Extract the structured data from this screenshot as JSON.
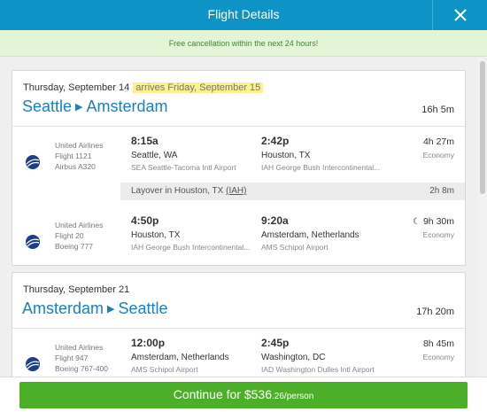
{
  "header": {
    "title": "Flight Details",
    "close_icon": "close-icon"
  },
  "banner": {
    "text": "Free cancellation within the next 24 hours!"
  },
  "trips": [
    {
      "date": "Thursday, September 14",
      "arrives_note": "arrives Friday, September 15",
      "origin": "Seattle",
      "destination": "Amsterdam",
      "duration": "16h 5m",
      "segments": [
        {
          "airline": "United Airlines",
          "flight": "Flight 1121",
          "aircraft": "Airbus A320",
          "dep_time": "8:15a",
          "dep_city": "Seattle, WA",
          "dep_airport": "SEA Seattle-Tacoma Intl Airport",
          "arr_time": "2:42p",
          "arr_city": "Houston, TX",
          "arr_airport": "IAH George Bush Intercontinental...",
          "duration": "4h 27m",
          "cabin": "Economy",
          "overnight": false
        },
        {
          "airline": "United Airlines",
          "flight": "Flight 20",
          "aircraft": "Boeing 777",
          "dep_time": "4:50p",
          "dep_city": "Houston, TX",
          "dep_airport": "IAH George Bush Intercontinental...",
          "arr_time": "9:20a",
          "arr_city": "Amsterdam, Netherlands",
          "arr_airport": "AMS Schipol Airport",
          "duration": "9h 30m",
          "cabin": "Economy",
          "overnight": true
        }
      ],
      "layover": {
        "prefix": "Layover in Houston, TX ",
        "code": "(IAH)",
        "duration": "2h 8m"
      }
    },
    {
      "date": "Thursday, September 21",
      "origin": "Amsterdam",
      "destination": "Seattle",
      "duration": "17h 20m",
      "segments": [
        {
          "airline": "United Airlines",
          "flight": "Flight 947",
          "aircraft": "Boeing 767-400",
          "dep_time": "12:00p",
          "dep_city": "Amsterdam, Netherlands",
          "dep_airport": "AMS Schipol Airport",
          "arr_time": "2:45p",
          "arr_city": "Washington, DC",
          "arr_airport": "IAD Washington Dulles Intl Airport",
          "duration": "8h 45m",
          "cabin": "Economy",
          "overnight": false
        }
      ]
    }
  ],
  "continue_button": {
    "label": "Continue for $536",
    "cents": ".26/person"
  },
  "colors": {
    "header": "#0d93c5",
    "route": "#1680c8",
    "button": "#4caf28",
    "banner": "#e3f5d6"
  }
}
